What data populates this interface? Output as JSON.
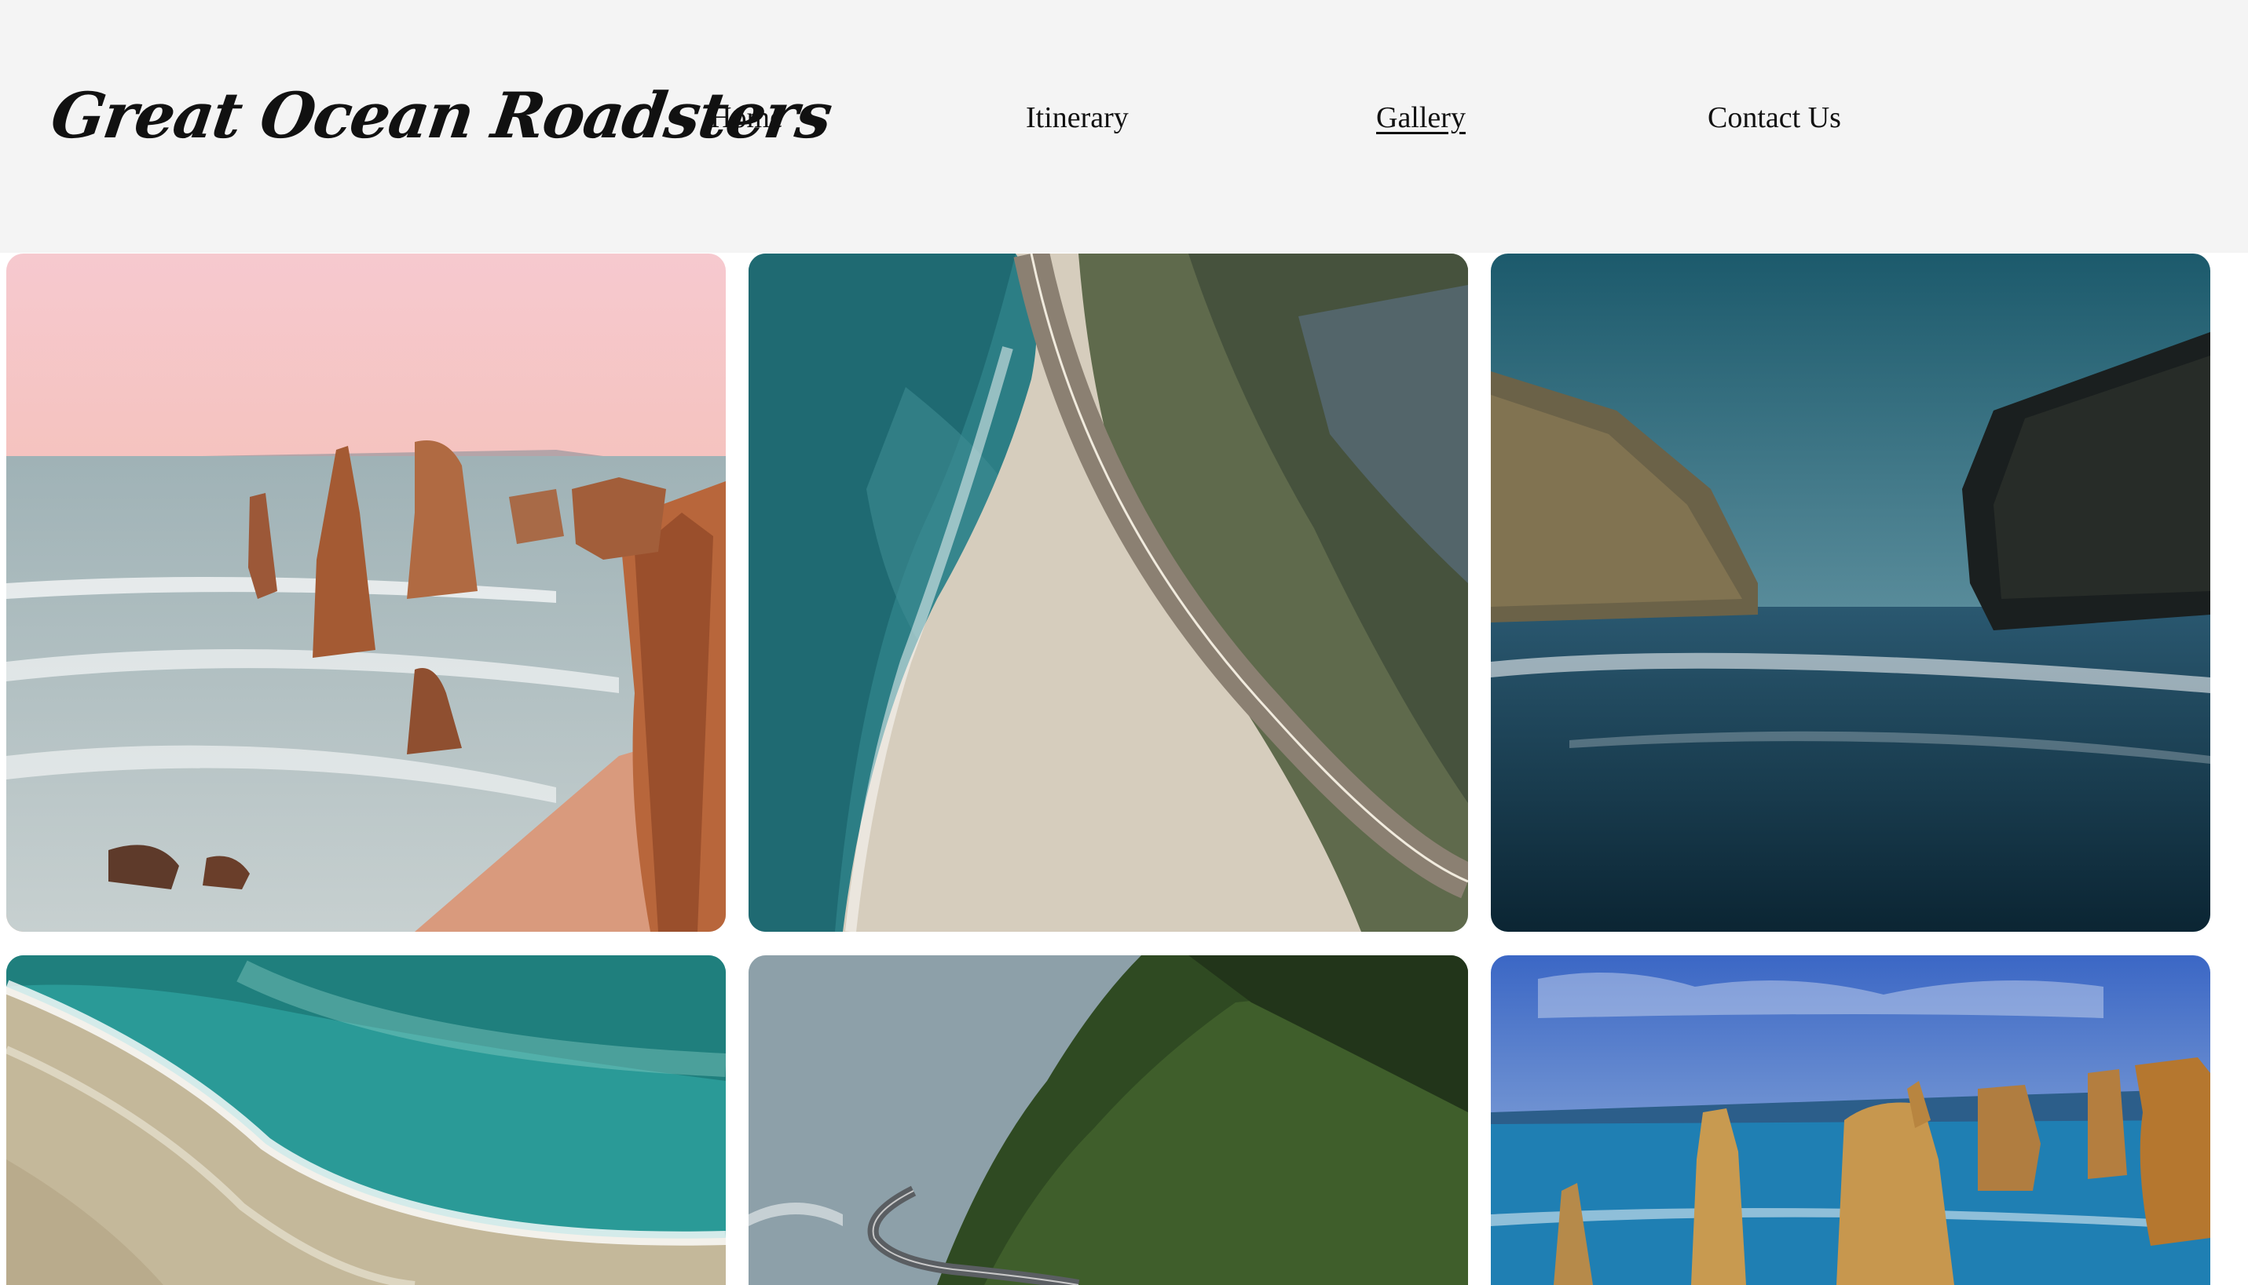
{
  "site": {
    "logo": "Great Ocean Roadsters"
  },
  "nav": {
    "items": [
      {
        "label": "Home",
        "active": false
      },
      {
        "label": "Itinerary",
        "active": false
      },
      {
        "label": "Gallery",
        "active": true
      },
      {
        "label": "Contact Us",
        "active": false
      }
    ]
  },
  "gallery": {
    "photos": [
      {
        "subject": "twelve-apostles-sunset"
      },
      {
        "subject": "coastal-road-aerial"
      },
      {
        "subject": "cliffs-ocean-blue"
      },
      {
        "subject": "turquoise-waves-aerial"
      },
      {
        "subject": "winding-road-forest"
      },
      {
        "subject": "twelve-apostles-daylight"
      }
    ]
  },
  "colors": {
    "header_bg": "#f4f4f4",
    "text": "#111111"
  }
}
